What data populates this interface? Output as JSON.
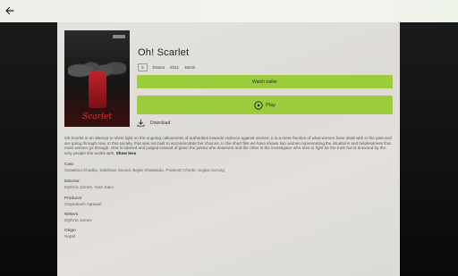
{
  "nav": {
    "back_icon": "arrow-left-icon"
  },
  "movie": {
    "title": "Oh! Scarlet",
    "rating_badge": "0",
    "genre": "Drama",
    "year": "2021",
    "duration": "18min",
    "poster_title": "Scarlet"
  },
  "actions": {
    "trailer_label": "Watch trailer",
    "play_label": "Play",
    "download_label": "Download"
  },
  "description": {
    "text": "Oh Scarlet is an attempt to shine light on the ongoing callousness of authorities towards violence against women. It is a mere fraction of what women have dealt with in the past and are going through now. In this society, that was not built to accommodate her choices. In the short film we have shown two women representing the situations and helplessness that most women go through. One is labeled and judged instead of given the justice she deserves and the other is the investigator who tries to fight for the truth but is drowned by the very people she works with.",
    "toggle": "Show less"
  },
  "details": [
    {
      "label": "Cast",
      "value": "Swastima Khadka, Saksham Suvedi, Bejan Khatiwada, Prateesh Chettri, Sujata Gurung"
    },
    {
      "label": "Director",
      "value": "Mythnis James, Yash Saini"
    },
    {
      "label": "Producer",
      "value": "Omprakash Agrawal"
    },
    {
      "label": "Writers",
      "value": "Mythnis James"
    },
    {
      "label": "Origin",
      "value": "Nepal"
    }
  ],
  "colors": {
    "accent": "#9ccb3b"
  }
}
